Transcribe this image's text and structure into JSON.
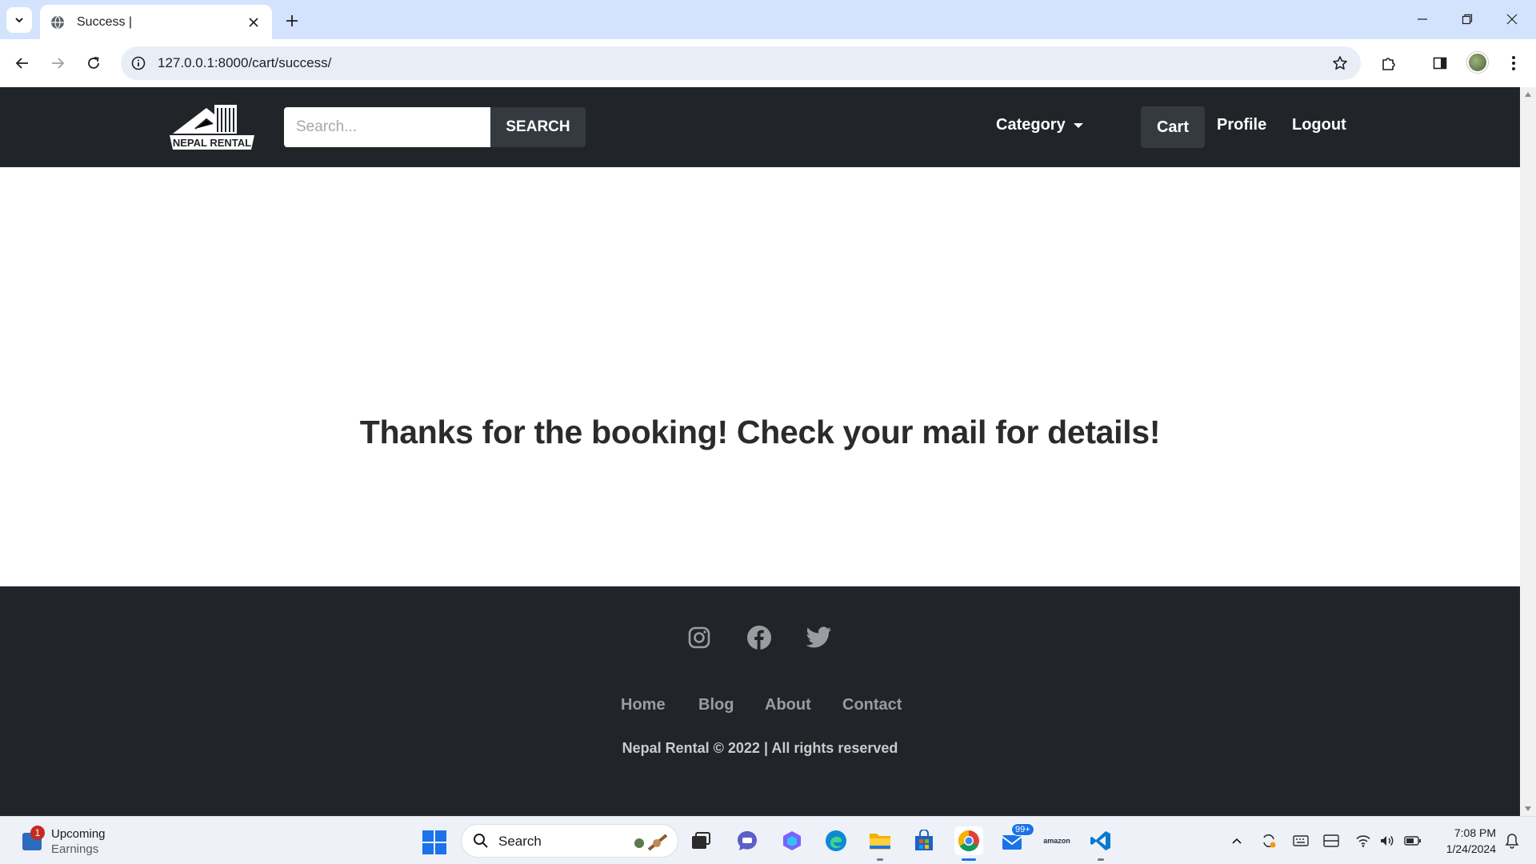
{
  "browser": {
    "tab_title": "Success |",
    "url": "127.0.0.1:8000/cart/success/"
  },
  "site": {
    "logo_text": "NEPAL RENTAL",
    "search_placeholder": "Search...",
    "search_button": "SEARCH",
    "category_label": "Category",
    "nav_links": {
      "cart": "Cart",
      "profile": "Profile",
      "logout": "Logout"
    },
    "message": "Thanks for the booking! Check your mail for details!",
    "footer": {
      "social_icons": [
        "instagram-icon",
        "facebook-icon",
        "twitter-icon"
      ],
      "links": [
        "Home",
        "Blog",
        "About",
        "Contact"
      ],
      "copyright": "Nepal Rental © 2022 | All rights reserved"
    },
    "colors": {
      "navbar_bg": "#212529",
      "button_bg": "#343a40",
      "text_dark": "#2b2b2b"
    }
  },
  "taskbar": {
    "widget_title": "Upcoming",
    "widget_subtitle": "Earnings",
    "widget_badge": "1",
    "search_label": "Search",
    "mail_badge": "99+",
    "amazon_label": "amazon",
    "time": "7:08 PM",
    "date": "1/24/2024"
  }
}
